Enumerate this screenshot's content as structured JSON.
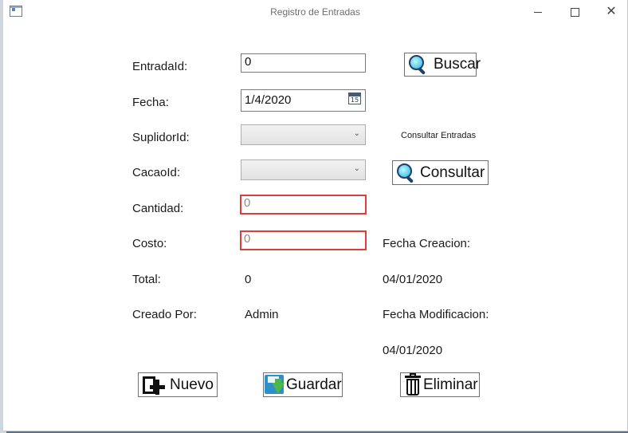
{
  "window": {
    "title": "Registro de Entradas",
    "controls": {
      "minimize": "—",
      "maximize": "□",
      "close": "✕"
    }
  },
  "form": {
    "entrada_id": {
      "label": "EntradaId:",
      "value": "0"
    },
    "fecha": {
      "label": "Fecha:",
      "value": "1/4/2020",
      "calendar_icon_text": "15"
    },
    "suplidor_id": {
      "label": "SuplidorId:",
      "value": ""
    },
    "cacao_id": {
      "label": "CacaoId:",
      "value": ""
    },
    "cantidad": {
      "label": "Cantidad:",
      "value": "0"
    },
    "costo": {
      "label": "Costo:",
      "value": "0"
    },
    "total": {
      "label": "Total:",
      "value": "0"
    },
    "creado_por": {
      "label": "Creado Por:",
      "value": "Admin"
    }
  },
  "side": {
    "buscar_label": "Buscar",
    "consultar_caption": "Consultar Entradas",
    "consultar_label": "Consultar",
    "fecha_creacion_label": "Fecha Creacion:",
    "fecha_creacion_value": "04/01/2020",
    "fecha_modificacion_label": "Fecha Modificacion:",
    "fecha_modificacion_value": "04/01/2020"
  },
  "actions": {
    "nuevo": "Nuevo",
    "guardar": "Guardar",
    "eliminar": "Eliminar"
  },
  "colors": {
    "validation_error": "#e03c3c",
    "magnifier_lens": "#24b5d8",
    "save_disk": "#2f8fc8",
    "save_arrow": "#4cb849"
  }
}
